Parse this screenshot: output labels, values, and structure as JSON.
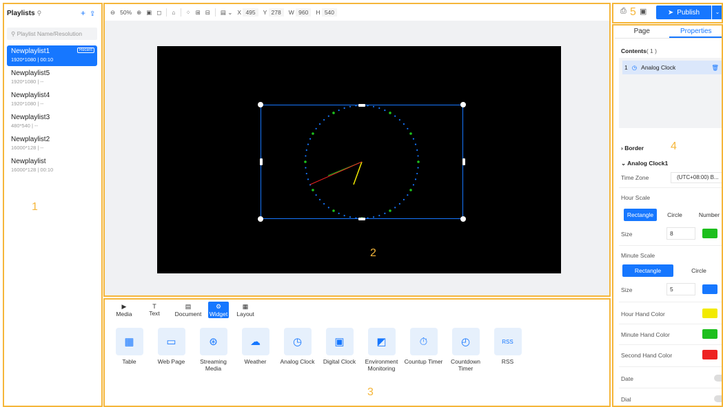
{
  "sidebar": {
    "title": "Playlists",
    "search_placeholder": "Playlist Name/Resolution",
    "items": [
      {
        "name": "Newplaylist1",
        "meta": "1920*1080 | 00:10",
        "badge": "Recent"
      },
      {
        "name": "Newplaylist5",
        "meta": "1920*1080 | --"
      },
      {
        "name": "Newplaylist4",
        "meta": "1920*1080 | --"
      },
      {
        "name": "Newplaylist3",
        "meta": "480*540 | --"
      },
      {
        "name": "Newplaylist2",
        "meta": "16000*128 | --"
      },
      {
        "name": "Newplaylist",
        "meta": "16000*128 | 00:10"
      }
    ]
  },
  "toolbar": {
    "zoom": "50%",
    "x_label": "X",
    "x": "495",
    "y_label": "Y",
    "y": "278",
    "w_label": "W",
    "w": "960",
    "h_label": "H",
    "h": "540"
  },
  "widget_tabs": [
    "Media",
    "Text",
    "Document",
    "Widget",
    "Layout"
  ],
  "widgets": [
    "Table",
    "Web Page",
    "Streaming Media",
    "Weather",
    "Analog Clock",
    "Digital Clock",
    "Environment Monitoring",
    "Countup Timer",
    "Countdown Timer",
    "RSS"
  ],
  "publish_label": "Publish",
  "props": {
    "tab_page": "Page",
    "tab_properties": "Properties",
    "contents_label": "Contents",
    "contents_count": "( 1 )",
    "content_item_index": "1",
    "content_item": "Analog Clock",
    "border": "Border",
    "section": "Analog Clock1",
    "timezone_label": "Time Zone",
    "timezone_value": "(UTC+08:00) B...",
    "hour_scale": "Hour Scale",
    "hour_scale_options": [
      "Rectangle",
      "Circle",
      "Number"
    ],
    "size_label": "Size",
    "hour_size": "8",
    "minute_scale": "Minute Scale",
    "minute_scale_options": [
      "Rectangle",
      "Circle"
    ],
    "minute_size": "5",
    "hour_hand": "Hour Hand Color",
    "minute_hand": "Minute Hand Color",
    "second_hand": "Second Hand Color",
    "date": "Date",
    "dial": "Dial"
  },
  "zone_labels": [
    "1",
    "2",
    "3",
    "4",
    "5"
  ],
  "colors": {
    "accent": "#1677ff",
    "zone": "#f5b63a",
    "hour_scale_color": "#1dbf1d",
    "minute_scale_color": "#1677ff",
    "hour_hand": "#f2ea00",
    "minute_hand": "#1dbf1d",
    "second_hand": "#ee2222"
  }
}
